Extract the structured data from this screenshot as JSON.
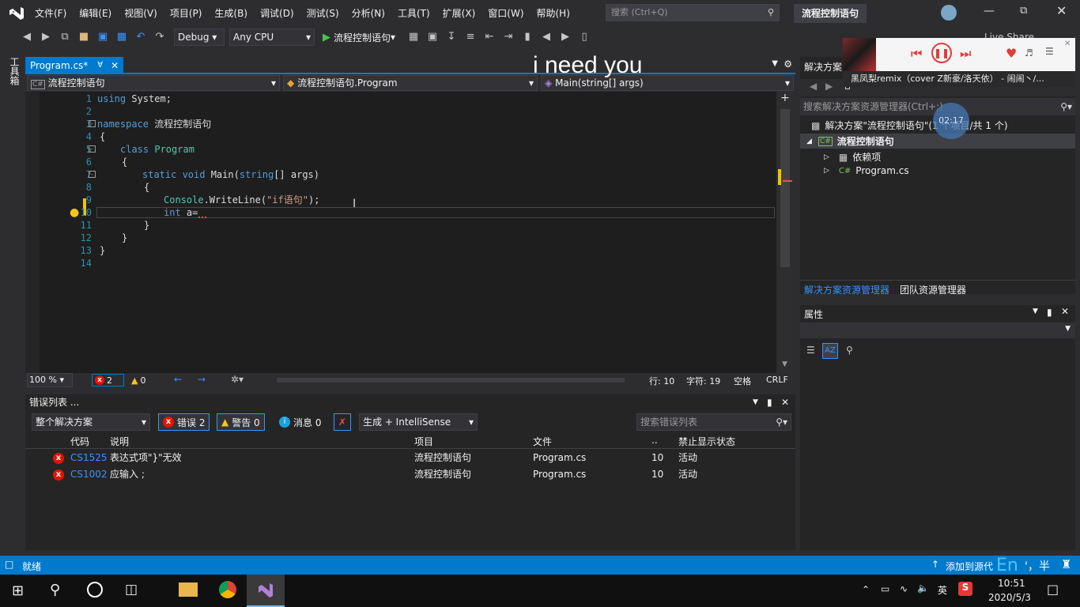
{
  "menu": [
    "文件(F)",
    "编辑(E)",
    "视图(V)",
    "项目(P)",
    "生成(B)",
    "调试(D)",
    "测试(S)",
    "分析(N)",
    "工具(T)",
    "扩展(X)",
    "窗口(W)",
    "帮助(H)"
  ],
  "search_placeholder": "搜索 (Ctrl+Q)",
  "solution_title": "流程控制语句",
  "toolbar": {
    "config": "Debug",
    "platform": "Any CPU",
    "start_label": "流程控制语句",
    "live_share": "Live Share"
  },
  "left_strip_label": "工具箱",
  "editor": {
    "tab": "Program.cs*",
    "nav_project": "流程控制语句",
    "nav_class": "流程控制语句.Program",
    "nav_member": "Main(string[] args)",
    "line_numbers": [
      "1",
      "2",
      "3",
      "4",
      "5",
      "6",
      "7",
      "8",
      "9",
      "10",
      "11",
      "12",
      "13",
      "14"
    ],
    "zoom": "100 %",
    "err_count": "2",
    "warn_count": "0",
    "row": "行: 10",
    "col": "字符: 19",
    "spacing": "空格",
    "eol": "CRLF"
  },
  "code": {
    "l1_kw": "using",
    "l1_rest": " System;",
    "l3_kw": "namespace",
    "l3_rest": " 流程控制语句",
    "l4": "{",
    "l5_kw": "class",
    "l5_ty": " Program",
    "l6": "{",
    "l7_kw1": "static",
    "l7_kw2": " void",
    "l7_rest1": " Main(",
    "l7_kw3": "string",
    "l7_rest2": "[] args)",
    "l8": "{",
    "l9_ty": "Console",
    "l9_rest1": ".WriteLine(",
    "l9_str": "\"if语句\"",
    "l9_rest2": ");",
    "l10_kw": "int",
    "l10_rest": " a=",
    "l11": "}",
    "l12": "}",
    "l13": "}"
  },
  "overlay_text": "i need you",
  "error_list": {
    "title": "错误列表 ...",
    "scope": "整个解决方案",
    "errors_btn": "错误 2",
    "warnings_btn": "警告 0",
    "messages_btn": "消息 0",
    "build_filter": "生成 + IntelliSense",
    "search_placeholder": "搜索错误列表",
    "columns": [
      "代码",
      "说明",
      "项目",
      "文件",
      "..",
      "禁止显示状态"
    ],
    "rows": [
      {
        "code": "CS1525",
        "desc": "表达式项\"}\"无效",
        "project": "流程控制语句",
        "file": "Program.cs",
        "line": "10",
        "state": "活动"
      },
      {
        "code": "CS1002",
        "desc": "应输入 ;",
        "project": "流程控制语句",
        "file": "Program.cs",
        "line": "10",
        "state": "活动"
      }
    ]
  },
  "solution_explorer": {
    "title": "解决方案",
    "search_placeholder": "搜索解决方案资源管理器(Ctrl+;)",
    "solution_node": "解决方案\"流程控制语句\"(1 个项目/共 1 个)",
    "project_node": "流程控制语句",
    "deps_node": "依赖项",
    "file_node": "Program.cs",
    "tab_solution": "解决方案资源管理器",
    "tab_team": "团队资源管理器",
    "timer": "02:17"
  },
  "properties": {
    "title": "属性"
  },
  "music": {
    "song": "黑凤梨remix（cover Z新豪/洛天依） - 闹闹丶/..."
  },
  "statusbar": {
    "ready": "就绪",
    "add_source": "添加到源代",
    "ime": "En",
    "ime_extra": "'，半"
  },
  "taskbar": {
    "time": "10:51",
    "date": "2020/5/3",
    "lang": "英"
  }
}
